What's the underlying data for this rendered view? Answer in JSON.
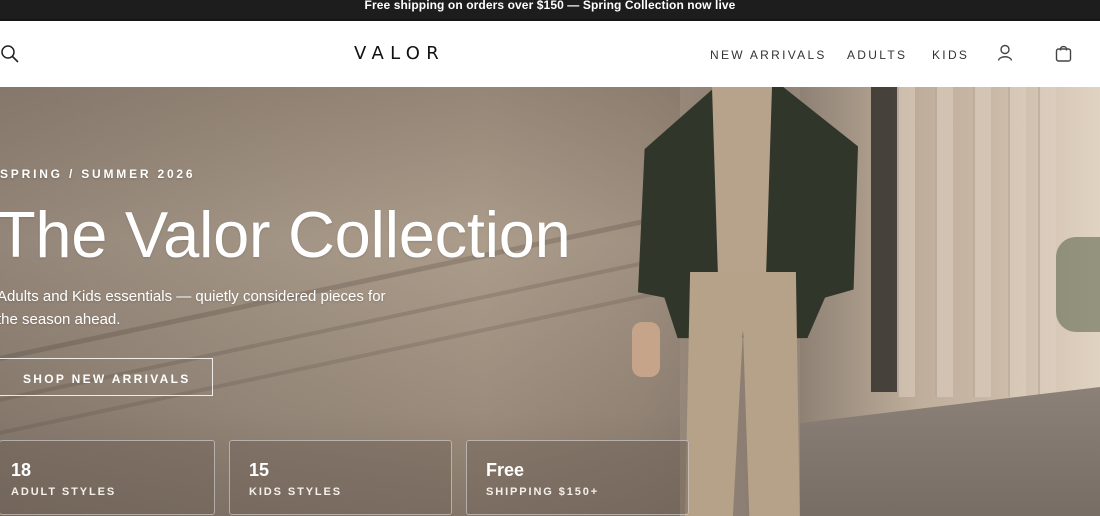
{
  "announcement": "Free shipping on orders over $150 — Spring Collection now live",
  "header": {
    "logo": "VALOR",
    "icons": {
      "search": "search-icon",
      "account": "user-icon",
      "cart": "shopping-bag-icon"
    },
    "nav": [
      {
        "label": "NEW ARRIVALS"
      },
      {
        "label": "ADULTS"
      },
      {
        "label": "KIDS"
      }
    ]
  },
  "hero": {
    "eyebrow": "SPRING / SUMMER 2026",
    "title": "The Valor Collection",
    "description": "Adults and Kids essentials — quietly considered pieces for the season ahead.",
    "cta": "SHOP NEW ARRIVALS",
    "stats": [
      {
        "value": "18",
        "label": "ADULT STYLES"
      },
      {
        "value": "15",
        "label": "KIDS STYLES"
      },
      {
        "value": "Free",
        "label": "SHIPPING $150+"
      }
    ]
  },
  "colors": {
    "announcement_bg": "#1d1d1d",
    "header_bg": "#ffffff",
    "text_dark": "#111111",
    "hero_text": "#ffffff"
  }
}
